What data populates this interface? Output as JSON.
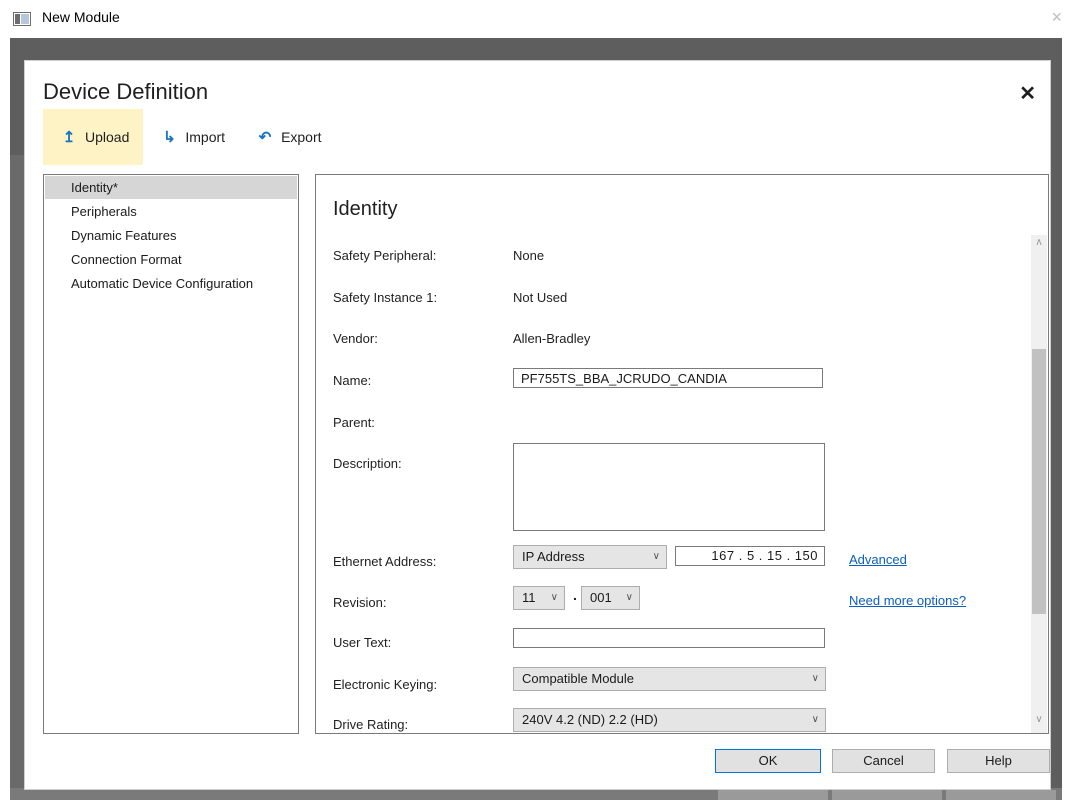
{
  "window": {
    "title": "New Module",
    "close_glyph": "×"
  },
  "dialog": {
    "title": "Device Definition",
    "close_glyph": "✕",
    "toolbar": {
      "upload": {
        "label": "Upload",
        "icon": "upload-icon",
        "glyph": "↥"
      },
      "import": {
        "label": "Import",
        "icon": "import-icon",
        "glyph": "↳"
      },
      "export": {
        "label": "Export",
        "icon": "export-icon",
        "glyph": "↶"
      }
    },
    "nav": [
      {
        "label": "Identity*",
        "selected": true
      },
      {
        "label": "Peripherals",
        "selected": false
      },
      {
        "label": "Dynamic Features",
        "selected": false
      },
      {
        "label": "Connection Format",
        "selected": false
      },
      {
        "label": "Automatic Device Configuration",
        "selected": false
      }
    ],
    "identity": {
      "heading": "Identity",
      "safety_peripheral": {
        "label": "Safety Peripheral:",
        "value": "None"
      },
      "safety_instance": {
        "label": "Safety Instance 1:",
        "value": "Not Used"
      },
      "vendor": {
        "label": "Vendor:",
        "value": "Allen-Bradley"
      },
      "name": {
        "label": "Name:",
        "value": "PF755TS_BBA_JCRUDO_CANDIA"
      },
      "parent": {
        "label": "Parent:",
        "value": ""
      },
      "description": {
        "label": "Description:",
        "value": ""
      },
      "ethernet": {
        "label": "Ethernet Address:",
        "type": "IP Address",
        "ip": "167 .  5  . 15 . 150",
        "link": "Advanced"
      },
      "revision": {
        "label": "Revision:",
        "major": "11",
        "minor": "001",
        "separator": ".",
        "link": "Need more options?"
      },
      "user_text": {
        "label": "User Text:",
        "value": ""
      },
      "electronic_keying": {
        "label": "Electronic Keying:",
        "value": "Compatible Module"
      },
      "drive_rating": {
        "label": "Drive Rating:",
        "value": "240V  4.2 (ND)  2.2 (HD)"
      }
    },
    "buttons": {
      "ok": "OK",
      "cancel": "Cancel",
      "help": "Help"
    }
  },
  "colors": {
    "accent": "#0078d7",
    "link": "#0b5fc1",
    "toolbar_active": "#fdf3c5",
    "icon_blue": "#1b73c4"
  }
}
